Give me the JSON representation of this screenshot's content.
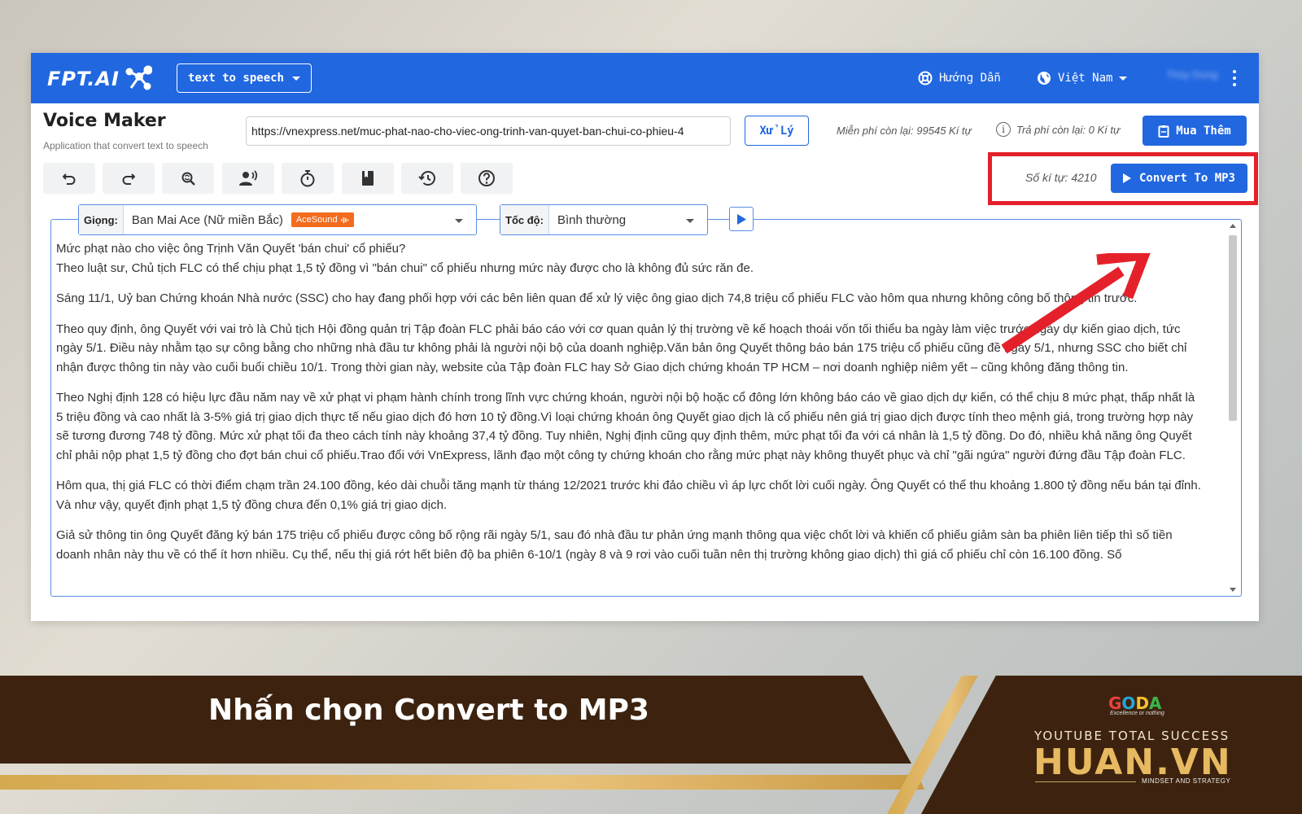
{
  "topbar": {
    "logo_text": "FPT.AI",
    "mode_select": "text to speech",
    "guide_label": "Hướng Dẫn",
    "language_label": "Việt Nam",
    "user_name": "Thùy Dung"
  },
  "header": {
    "title": "Voice Maker",
    "subtitle": "Application that convert text to speech",
    "url_value": "https://vnexpress.net/muc-phat-nao-cho-viec-ong-trinh-van-quyet-ban-chui-co-phieu-4",
    "process_label": "Xử Lý",
    "free_quota": "Miễn phí còn lại: 99545 Kí tự",
    "paid_quota": "Trả phí còn lại: 0 Kí tự",
    "buy_label": "Mua Thêm"
  },
  "toolbar": {
    "tools": [
      "undo-icon",
      "redo-icon",
      "search-replace-icon",
      "voice-speaker-icon",
      "timer-icon",
      "bookmark-icon",
      "history-icon",
      "help-icon"
    ],
    "char_count": "Số kí tự: 4210",
    "convert_label": "Convert To MP3"
  },
  "controls": {
    "voice_label": "Giọng:",
    "voice_value": "Ban Mai Ace (Nữ miền Bắc)",
    "voice_badge": "AceSound",
    "speed_label": "Tốc độ:",
    "speed_value": "Bình thường"
  },
  "content": {
    "line1": "Mức phạt nào cho việc ông Trịnh Văn Quyết 'bán chui' cổ phiếu?",
    "line2": "Theo luật sư, Chủ tịch FLC có thể chịu phạt 1,5 tỷ đồng vì \"bán chui\" cổ phiếu nhưng mức này được cho là không đủ sức răn đe.",
    "p2": "Sáng 11/1, Uỷ ban Chứng khoán Nhà nước (SSC) cho hay đang phối hợp với các bên liên quan để xử lý việc ông giao dịch 74,8 triệu cổ phiếu FLC vào hôm qua nhưng không công bố thông tin trước.",
    "p3": "Theo quy định, ông Quyết với vai trò là Chủ tịch Hội đồng quản trị Tập đoàn FLC phải báo cáo với cơ quan quản lý thị trường về kế hoạch thoái vốn tối thiểu ba ngày làm việc trước ngày dự kiến giao dịch, tức ngày 5/1. Điều này nhằm tạo sự công bằng cho những nhà đầu tư không phải là người nội bộ của doanh nghiệp.Văn bản ông Quyết thông báo bán 175 triệu cổ phiếu cũng đề ngày 5/1, nhưng SSC cho biết chỉ nhận được thông tin này vào cuối buổi chiều 10/1. Trong thời gian này, website của Tập đoàn FLC hay Sở Giao dịch chứng khoán TP HCM – nơi doanh nghiệp niêm yết – cũng không đăng thông tin.",
    "p4": "Theo Nghị định 128 có hiệu lực đầu năm nay về xử phạt vi phạm hành chính trong lĩnh vực chứng khoán, người nội bộ hoặc cổ đông lớn không báo cáo về giao dịch dự kiến, có thể chịu 8 mức phạt, thấp nhất là 5 triệu đồng và cao nhất là 3-5% giá trị giao dịch thực tế nếu giao dịch đó hơn 10 tỷ đồng.Vì loại chứng khoán ông Quyết giao dịch là cổ phiếu nên giá trị giao dịch được tính theo mệnh giá, trong trường hợp này sẽ tương đương 748 tỷ đồng. Mức xử phạt tối đa theo cách tính này khoảng 37,4 tỷ đồng. Tuy nhiên, Nghị định cũng quy định thêm, mức phạt tối đa với cá nhân là 1,5 tỷ đồng. Do đó, nhiều khả năng ông Quyết chỉ phải nộp phạt 1,5 tỷ đồng cho đợt bán chui cổ phiếu.Trao đổi với VnExpress, lãnh đạo một công ty chứng khoán cho rằng mức phạt này không thuyết phục và chỉ \"gãi ngứa\" người đứng đầu Tập đoàn FLC.",
    "p5": "Hôm qua, thị giá FLC có thời điểm chạm trần 24.100 đồng, kéo dài chuỗi tăng mạnh từ tháng 12/2021 trước khi đảo chiều vì áp lực chốt lời cuối ngày. Ông Quyết có thể thu khoảng 1.800 tỷ đồng nếu bán tại đỉnh. Và như vậy, quyết định phạt 1,5 tỷ đồng chưa đến 0,1% giá trị giao dịch.",
    "p6": "Giả sử thông tin ông Quyết đăng ký bán 175 triệu cổ phiếu được công bố rộng rãi ngày 5/1, sau đó nhà đầu tư phản ứng mạnh thông qua việc chốt lời và khiến cổ phiếu giảm sàn ba phiên liên tiếp thì số tiền doanh nhân này thu về có thể ít hơn nhiều. Cụ thể, nếu thị giá rớt hết biên độ ba phiên 6-10/1 (ngày 8 và 9 rơi vào cuối tuần nên thị trường không giao dịch) thì giá cổ phiếu chỉ còn 16.100 đồng. Số"
  },
  "banner": {
    "caption": "Nhấn chọn Convert to MP3",
    "goda": "GODA",
    "goda_tagline": "Excellence or nothing",
    "youtube_total": "YOUTUBE TOTAL SUCCESS",
    "brand": "HUAN.VN",
    "mindset": "MINDSET AND STRATEGY"
  },
  "colors": {
    "brand_blue": "#2167e0",
    "highlight_red": "#e4212a",
    "banner_brown": "#3d230f",
    "banner_gold": "#e7b960"
  }
}
